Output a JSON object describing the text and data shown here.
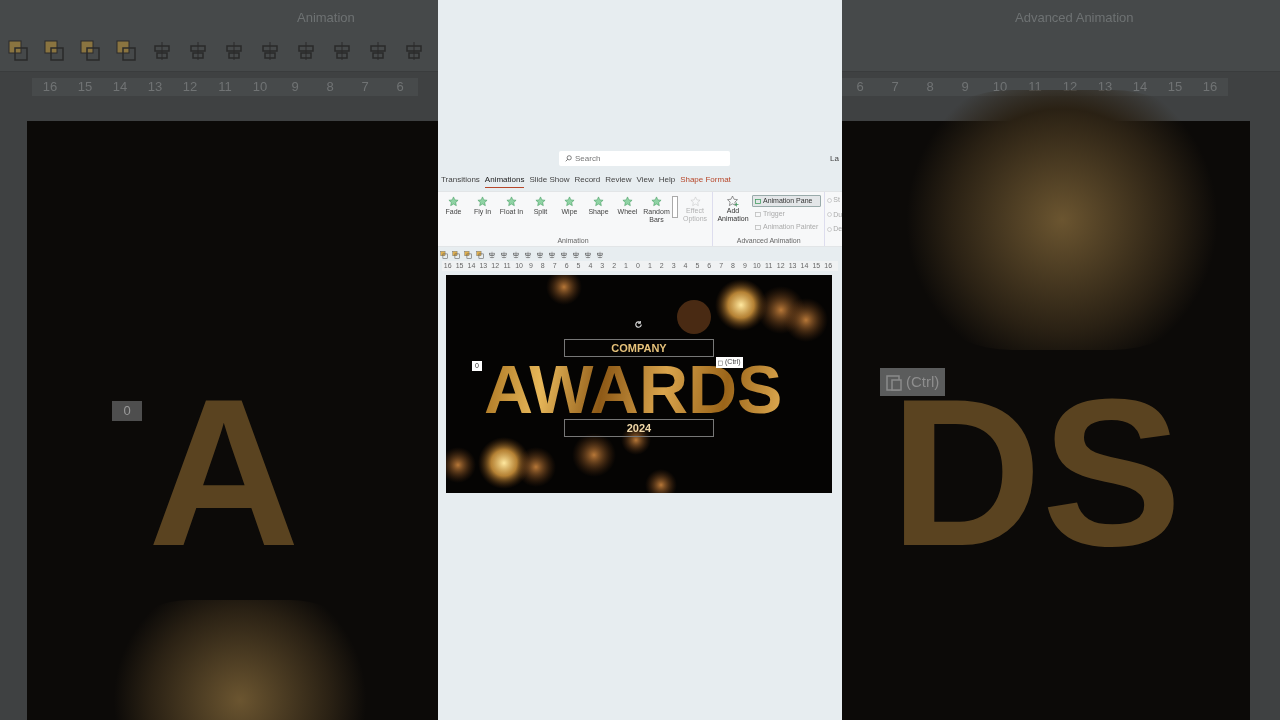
{
  "backdrop": {
    "left": {
      "group_label": "Animation",
      "ruler": [
        "16",
        "15",
        "14",
        "13",
        "12",
        "11",
        "10",
        "9",
        "8",
        "7",
        "6"
      ],
      "slide_text": "A",
      "order_tag": "0"
    },
    "right": {
      "group_label": "Advanced Animation",
      "ruler": [
        "6",
        "7",
        "8",
        "9",
        "10",
        "11",
        "12",
        "13",
        "14",
        "15",
        "16"
      ],
      "slide_text": "DS",
      "paste_label": "(Ctrl)"
    }
  },
  "search": {
    "placeholder": "Search"
  },
  "account_text": "La",
  "tabs": [
    {
      "label": "Transitions",
      "selected": false,
      "contextual": false
    },
    {
      "label": "Animations",
      "selected": true,
      "contextual": false
    },
    {
      "label": "Slide Show",
      "selected": false,
      "contextual": false
    },
    {
      "label": "Record",
      "selected": false,
      "contextual": false
    },
    {
      "label": "Review",
      "selected": false,
      "contextual": false
    },
    {
      "label": "View",
      "selected": false,
      "contextual": false
    },
    {
      "label": "Help",
      "selected": false,
      "contextual": false
    },
    {
      "label": "Shape Format",
      "selected": false,
      "contextual": true
    }
  ],
  "animation_group": {
    "effects": [
      "Fade",
      "Fly In",
      "Float In",
      "Split",
      "Wipe",
      "Shape",
      "Wheel",
      "Random Bars"
    ],
    "effect_options": {
      "label": "Effect Options",
      "disabled": true
    },
    "group_label": "Animation"
  },
  "advanced_group": {
    "add_animation": "Add Animation",
    "items": [
      {
        "label": "Animation Pane",
        "disabled": false,
        "selected": true
      },
      {
        "label": "Trigger",
        "disabled": true,
        "selected": false
      },
      {
        "label": "Animation Painter",
        "disabled": true,
        "selected": false
      }
    ],
    "group_label": "Advanced Animation"
  },
  "timing_cut": [
    "St",
    "Du",
    "De"
  ],
  "ruler": [
    "16",
    "15",
    "14",
    "13",
    "12",
    "11",
    "10",
    "9",
    "8",
    "7",
    "6",
    "5",
    "4",
    "3",
    "2",
    "1",
    "0",
    "1",
    "2",
    "3",
    "4",
    "5",
    "6",
    "7",
    "8",
    "9",
    "10",
    "11",
    "12",
    "13",
    "14",
    "15",
    "16"
  ],
  "slide": {
    "top_line": "COMPANY",
    "title": "AWARDS",
    "subtitle": "2024",
    "order_tag": "0",
    "paste_label": "(Ctrl)"
  }
}
